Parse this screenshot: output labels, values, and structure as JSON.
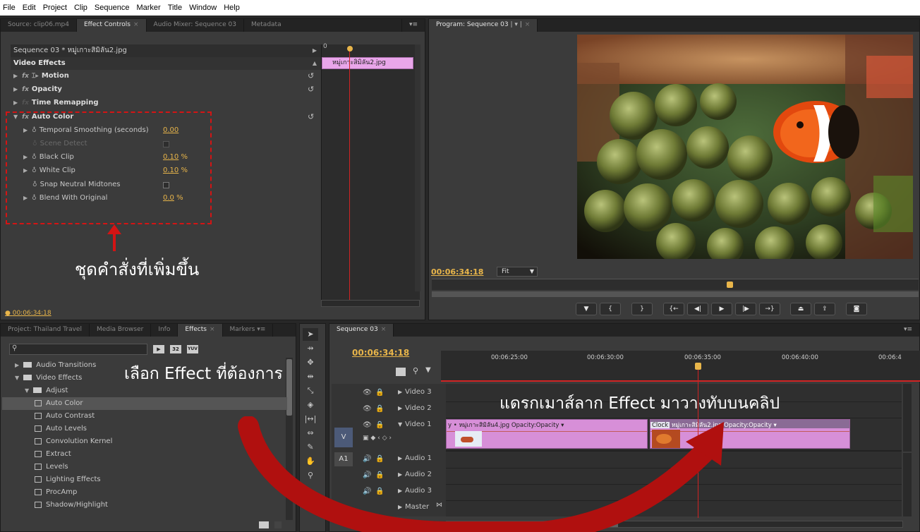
{
  "menu": [
    "File",
    "Edit",
    "Project",
    "Clip",
    "Sequence",
    "Marker",
    "Title",
    "Window",
    "Help"
  ],
  "top_left_tabs": {
    "source": "Source: clip06.mp4",
    "effect_controls": "Effect Controls",
    "audio_mixer": "Audio Mixer: Sequence 03",
    "metadata": "Metadata"
  },
  "effect_controls": {
    "clip_header": "Sequence 03 * หมู่เกาะสิมิลัน2.jpg",
    "mini_clip_label": "หมู่เกาะสิมิลัน2.jpg",
    "ruler_zero": "0",
    "section": "Video Effects",
    "effects": [
      "Motion",
      "Opacity",
      "Time Remapping",
      "Auto Color"
    ],
    "params": [
      {
        "label": "Temporal Smoothing (seconds)",
        "value": "0.00",
        "unit": ""
      },
      {
        "label": "Scene Detect",
        "value": "",
        "unit": ""
      },
      {
        "label": "Black Clip",
        "value": "0.10",
        "unit": "%"
      },
      {
        "label": "White Clip",
        "value": "0.10",
        "unit": "%"
      },
      {
        "label": "Snap Neutral Midtones",
        "value": "",
        "unit": ""
      },
      {
        "label": "Blend With Original",
        "value": "0.0",
        "unit": "%"
      }
    ],
    "timecode": "00:06:34:18"
  },
  "program": {
    "tab": "Program: Sequence 03",
    "timecode": "00:06:34:18",
    "fit": "Fit"
  },
  "project_tabs": {
    "project": "Project: Thailand Travel",
    "media_browser": "Media Browser",
    "info": "Info",
    "effects": "Effects",
    "markers": "Markers"
  },
  "effects_tree": [
    {
      "label": "Audio Transitions",
      "level": 0,
      "type": "folder",
      "open": false
    },
    {
      "label": "Video Effects",
      "level": 0,
      "type": "folder",
      "open": true
    },
    {
      "label": "Adjust",
      "level": 1,
      "type": "folder",
      "open": true
    },
    {
      "label": "Auto Color",
      "level": 2,
      "type": "effect",
      "selected": true
    },
    {
      "label": "Auto Contrast",
      "level": 2,
      "type": "effect"
    },
    {
      "label": "Auto Levels",
      "level": 2,
      "type": "effect"
    },
    {
      "label": "Convolution Kernel",
      "level": 2,
      "type": "effect"
    },
    {
      "label": "Extract",
      "level": 2,
      "type": "effect"
    },
    {
      "label": "Levels",
      "level": 2,
      "type": "effect"
    },
    {
      "label": "Lighting Effects",
      "level": 2,
      "type": "effect"
    },
    {
      "label": "ProcAmp",
      "level": 2,
      "type": "effect"
    },
    {
      "label": "Shadow/Highlight",
      "level": 2,
      "type": "effect"
    }
  ],
  "timeline": {
    "tab": "Sequence 03",
    "timecode": "00:06:34:18",
    "ticks": [
      "00:06:25:00",
      "00:06:30:00",
      "00:06:35:00",
      "00:06:40:00",
      "00:06:4"
    ],
    "video_tracks": [
      "Video 3",
      "Video 2",
      "Video 1"
    ],
    "audio_tracks": [
      "Audio 1",
      "Audio 2",
      "Audio 3",
      "Master"
    ],
    "v_label": "V",
    "a_label": "A1",
    "clip1_label": "y • หมู่เกาะสิมิลัน4.jpg  Opacity:Opacity ▾",
    "clip2_prefix": "Clock",
    "clip2_label": "หมู่เกาะสิมิลัน2.jpg  Opacity:Opacity ▾"
  },
  "annotations": {
    "added_commands": "ชุดคำสั่งที่เพิ่มขึ้น",
    "choose_effect": "เลือก Effect ที่ต้องการ",
    "drag_effect": "แดรกเมาส์ลาก Effect มาวางทับบนคลิป"
  },
  "colors": {
    "accent": "#e8b54a",
    "clip": "#d78fd8",
    "annotation_red": "#d41414",
    "arrow_red": "#b0100f"
  }
}
